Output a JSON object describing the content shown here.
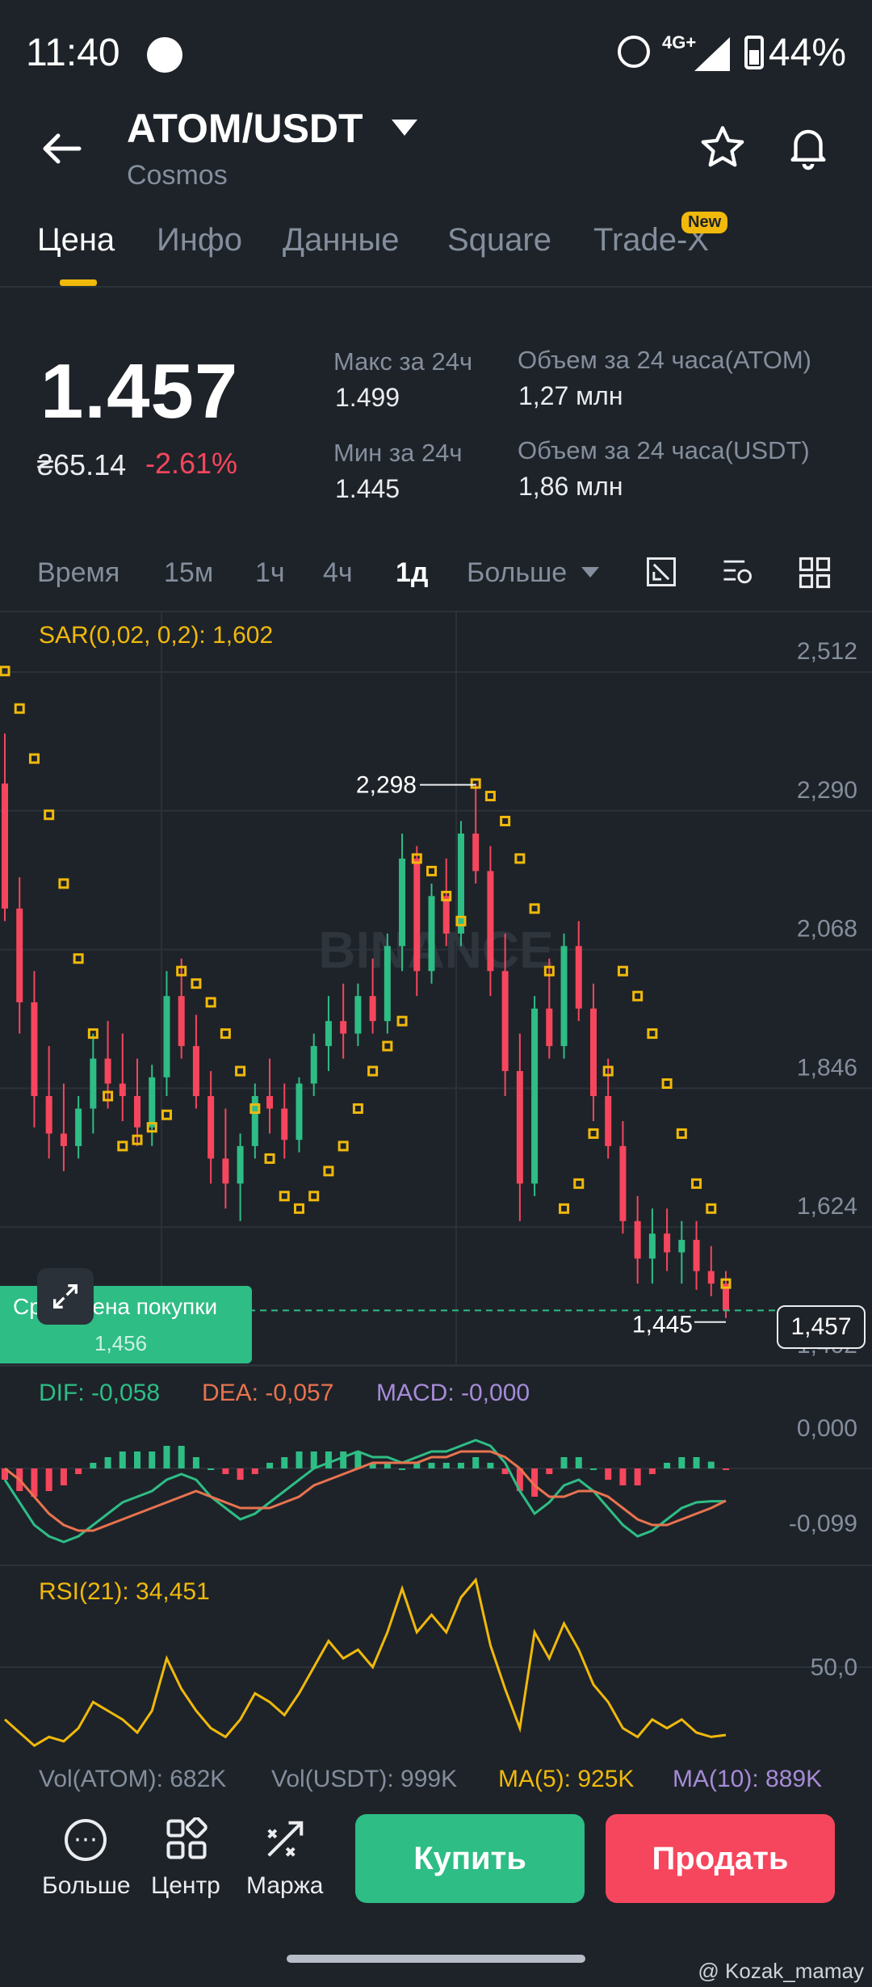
{
  "status": {
    "time": "11:40",
    "network": "4G+",
    "battery": "44%"
  },
  "header": {
    "pair": "ATOM/USDT",
    "subtitle": "Cosmos"
  },
  "tabs": [
    {
      "label": "Цена"
    },
    {
      "label": "Инфо"
    },
    {
      "label": "Данные"
    },
    {
      "label": "Square"
    },
    {
      "label": "Trade-X"
    }
  ],
  "new_badge": "New",
  "price": {
    "last": "1.457",
    "local": "₴65.14",
    "change": "-2.61%"
  },
  "stats": {
    "high_label": "Макс за 24ч",
    "high": "1.499",
    "low_label": "Мин за 24ч",
    "low": "1.445",
    "vol_atom_label": "Объем за 24 часа(ATOM)",
    "vol_atom": "1,27 млн",
    "vol_usdt_label": "Объем за 24 часа(USDT)",
    "vol_usdt": "1,86 млн"
  },
  "timeframes": [
    "Время",
    "15м",
    "1ч",
    "4ч",
    "1д",
    "Больше"
  ],
  "active_timeframe": "1д",
  "sar_label": "SAR(0,02, 0,2): 1,602",
  "macd_labels": {
    "dif": "DIF: -0,058",
    "dea": "DEA: -0,057",
    "macd": "MACD: -0,000"
  },
  "rsi_label": "RSI(21): 34,451",
  "vol_labels": {
    "vol_atom": "Vol(ATOM): 682K",
    "vol_usdt": "Vol(USDT): 999K",
    "ma5": "MA(5): 925K",
    "ma10": "MA(10): 889K"
  },
  "avg_price": {
    "label": "Сред. цена покупки",
    "value": "1,456"
  },
  "watermark_text": "BINANCE",
  "bottom": {
    "more": "Больше",
    "center": "Центр",
    "margin": "Маржа",
    "buy": "Купить",
    "sell": "Продать"
  },
  "credit": "@ Kozak_mamay",
  "colors": {
    "up": "#2ebd85",
    "down": "#f6465d",
    "sar": "#f0b90b",
    "dea": "#e8734f",
    "macd": "#a78bd8"
  },
  "chart_data": [
    {
      "type": "candlestick",
      "title": "",
      "y_axis_ticks": [
        "2,512",
        "2,290",
        "2,068",
        "1,846",
        "1,624",
        "1,402"
      ],
      "ylim": [
        1.402,
        2.512
      ],
      "annotations": {
        "high": "2,298",
        "low": "1,445",
        "current": "1,457"
      },
      "candles": [
        [
          2.3,
          2.38,
          2.08,
          2.1
        ],
        [
          2.1,
          2.15,
          1.9,
          1.95
        ],
        [
          1.95,
          2.0,
          1.75,
          1.8
        ],
        [
          1.8,
          1.88,
          1.7,
          1.74
        ],
        [
          1.74,
          1.82,
          1.68,
          1.72
        ],
        [
          1.72,
          1.8,
          1.7,
          1.78
        ],
        [
          1.78,
          1.9,
          1.74,
          1.86
        ],
        [
          1.86,
          1.92,
          1.78,
          1.82
        ],
        [
          1.82,
          1.9,
          1.76,
          1.8
        ],
        [
          1.8,
          1.86,
          1.72,
          1.75
        ],
        [
          1.75,
          1.85,
          1.72,
          1.83
        ],
        [
          1.83,
          2.0,
          1.8,
          1.96
        ],
        [
          1.96,
          2.02,
          1.86,
          1.88
        ],
        [
          1.88,
          1.93,
          1.78,
          1.8
        ],
        [
          1.8,
          1.84,
          1.66,
          1.7
        ],
        [
          1.7,
          1.78,
          1.62,
          1.66
        ],
        [
          1.66,
          1.74,
          1.6,
          1.72
        ],
        [
          1.72,
          1.82,
          1.7,
          1.8
        ],
        [
          1.8,
          1.86,
          1.74,
          1.78
        ],
        [
          1.78,
          1.82,
          1.7,
          1.73
        ],
        [
          1.73,
          1.83,
          1.71,
          1.82
        ],
        [
          1.82,
          1.9,
          1.8,
          1.88
        ],
        [
          1.88,
          1.96,
          1.84,
          1.92
        ],
        [
          1.92,
          1.98,
          1.86,
          1.9
        ],
        [
          1.9,
          1.98,
          1.88,
          1.96
        ],
        [
          1.96,
          2.02,
          1.9,
          1.92
        ],
        [
          1.92,
          2.06,
          1.9,
          2.04
        ],
        [
          2.04,
          2.22,
          2.0,
          2.18
        ],
        [
          2.18,
          2.2,
          1.96,
          2.0
        ],
        [
          2.0,
          2.14,
          1.98,
          2.12
        ],
        [
          2.12,
          2.18,
          2.04,
          2.06
        ],
        [
          2.06,
          2.24,
          2.04,
          2.22
        ],
        [
          2.22,
          2.3,
          2.14,
          2.16
        ],
        [
          2.16,
          2.2,
          1.96,
          2.0
        ],
        [
          2.0,
          2.06,
          1.8,
          1.84
        ],
        [
          1.84,
          1.9,
          1.6,
          1.66
        ],
        [
          1.66,
          1.96,
          1.64,
          1.94
        ],
        [
          1.94,
          2.02,
          1.86,
          1.88
        ],
        [
          1.88,
          2.06,
          1.86,
          2.04
        ],
        [
          2.04,
          2.08,
          1.92,
          1.94
        ],
        [
          1.94,
          1.98,
          1.76,
          1.8
        ],
        [
          1.8,
          1.86,
          1.7,
          1.72
        ],
        [
          1.72,
          1.76,
          1.58,
          1.6
        ],
        [
          1.6,
          1.64,
          1.5,
          1.54
        ],
        [
          1.54,
          1.62,
          1.5,
          1.58
        ],
        [
          1.58,
          1.62,
          1.52,
          1.55
        ],
        [
          1.55,
          1.6,
          1.5,
          1.57
        ],
        [
          1.57,
          1.6,
          1.49,
          1.52
        ],
        [
          1.52,
          1.56,
          1.48,
          1.5
        ],
        [
          1.5,
          1.52,
          1.445,
          1.457
        ]
      ],
      "sar": [
        2.48,
        2.42,
        2.34,
        2.25,
        2.14,
        2.02,
        1.9,
        1.8,
        1.72,
        1.73,
        1.75,
        1.77,
        2.0,
        1.98,
        1.95,
        1.9,
        1.84,
        1.78,
        1.7,
        1.64,
        1.62,
        1.64,
        1.68,
        1.72,
        1.78,
        1.84,
        1.88,
        1.92,
        2.18,
        2.16,
        2.12,
        2.08,
        2.3,
        2.28,
        2.24,
        2.18,
        2.1,
        2.0,
        1.62,
        1.66,
        1.74,
        1.84,
        2.0,
        1.96,
        1.9,
        1.82,
        1.74,
        1.66,
        1.62,
        1.5
      ]
    },
    {
      "type": "bar",
      "title": "MACD",
      "y_axis_ticks": [
        "0,000",
        "-0,099"
      ],
      "series": [
        {
          "name": "DIF",
          "values": [
            -0.02,
            -0.06,
            -0.1,
            -0.12,
            -0.13,
            -0.12,
            -0.1,
            -0.08,
            -0.06,
            -0.05,
            -0.04,
            -0.02,
            -0.01,
            -0.02,
            -0.05,
            -0.07,
            -0.09,
            -0.08,
            -0.06,
            -0.04,
            -0.02,
            0.0,
            0.01,
            0.02,
            0.03,
            0.02,
            0.02,
            0.01,
            0.02,
            0.03,
            0.03,
            0.04,
            0.05,
            0.04,
            0.01,
            -0.04,
            -0.08,
            -0.06,
            -0.03,
            -0.02,
            -0.04,
            -0.07,
            -0.1,
            -0.12,
            -0.11,
            -0.09,
            -0.07,
            -0.06,
            -0.058,
            -0.058
          ]
        },
        {
          "name": "DEA",
          "values": [
            0.0,
            -0.02,
            -0.05,
            -0.08,
            -0.1,
            -0.11,
            -0.11,
            -0.1,
            -0.09,
            -0.08,
            -0.07,
            -0.06,
            -0.05,
            -0.04,
            -0.05,
            -0.06,
            -0.07,
            -0.07,
            -0.07,
            -0.06,
            -0.05,
            -0.03,
            -0.02,
            -0.01,
            0.0,
            0.01,
            0.01,
            0.01,
            0.01,
            0.02,
            0.02,
            0.03,
            0.03,
            0.03,
            0.02,
            0.0,
            -0.03,
            -0.05,
            -0.05,
            -0.04,
            -0.04,
            -0.05,
            -0.07,
            -0.09,
            -0.1,
            -0.1,
            -0.09,
            -0.08,
            -0.07,
            -0.057
          ]
        },
        {
          "name": "MACD",
          "values": [
            -0.02,
            -0.04,
            -0.05,
            -0.04,
            -0.03,
            -0.01,
            0.01,
            0.02,
            0.03,
            0.03,
            0.03,
            0.04,
            0.04,
            0.02,
            0.0,
            -0.01,
            -0.02,
            -0.01,
            0.01,
            0.02,
            0.03,
            0.03,
            0.03,
            0.03,
            0.03,
            0.01,
            0.01,
            0.0,
            0.01,
            0.01,
            0.01,
            0.01,
            0.02,
            0.01,
            -0.01,
            -0.04,
            -0.05,
            -0.01,
            0.02,
            0.02,
            0.0,
            -0.02,
            -0.03,
            -0.03,
            -0.01,
            0.01,
            0.02,
            0.02,
            0.012,
            -0.001
          ]
        }
      ]
    },
    {
      "type": "line",
      "title": "RSI",
      "y_axis_ticks": [
        "50,0"
      ],
      "series": [
        {
          "name": "RSI",
          "values": [
            38,
            35,
            32,
            34,
            33,
            36,
            42,
            40,
            38,
            35,
            40,
            52,
            45,
            40,
            36,
            34,
            38,
            44,
            42,
            39,
            44,
            50,
            56,
            52,
            54,
            50,
            58,
            68,
            58,
            62,
            58,
            66,
            70,
            55,
            45,
            36,
            58,
            52,
            60,
            54,
            46,
            42,
            36,
            34,
            38,
            36,
            38,
            35,
            34,
            34.451
          ]
        }
      ]
    }
  ]
}
